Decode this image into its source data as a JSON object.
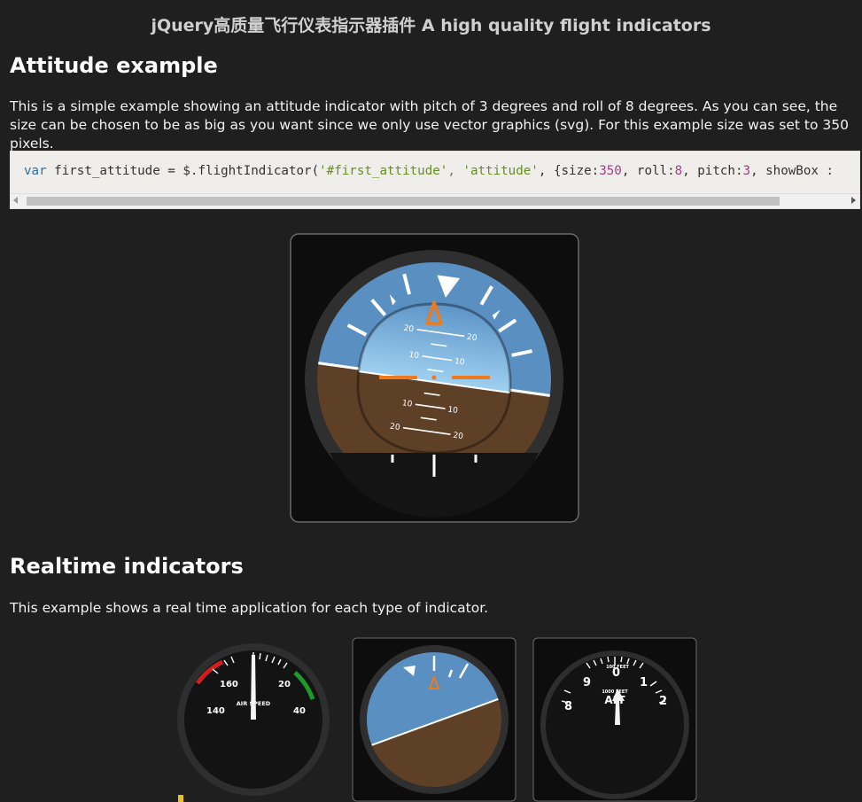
{
  "page": {
    "title": "jQuery高质量飞行仪表指示器插件 A high quality flight indicators"
  },
  "attitude_section": {
    "heading": "Attitude example",
    "description": "This is a simple example showing an attitude indicator with pitch of 3 degrees and roll of 8 degrees. As you can see, the size can be chosen to be as big as you want since we only use vector graphics (svg). For this example size was set to 350 pixels.",
    "code": {
      "keyword": "var",
      "ident": " first_attitude = $.flightIndicator(",
      "arg1": "'#first_attitude'",
      "sep1": ", ",
      "arg2": "'attitude'",
      "sep2": ", {size:",
      "size": "350",
      "sep3": ", roll:",
      "roll": "8",
      "sep4": ", pitch:",
      "pitch": "3",
      "tail": ", showBox : "
    },
    "indicator": {
      "roll_deg": 8,
      "pitch_deg": 3,
      "pitch_labels": [
        "20",
        "10",
        "10",
        "20"
      ]
    }
  },
  "realtime_section": {
    "heading": "Realtime indicators",
    "description": "This example shows a real time application for each type of indicator.",
    "airspeed": {
      "labels": [
        "160",
        "20",
        "140",
        "40"
      ],
      "caption": "AIR SPEED"
    },
    "altimeter": {
      "labels": [
        "0",
        "9",
        "1",
        "8",
        "2"
      ],
      "caption_top": "100 FEET",
      "caption_mid": "1000 FEET",
      "caption_big": "ALT"
    }
  },
  "colors": {
    "background": "#1f1f1f",
    "sky": "#5a8fc2",
    "ground": "#5e4027",
    "marker": "#f07a1a"
  }
}
